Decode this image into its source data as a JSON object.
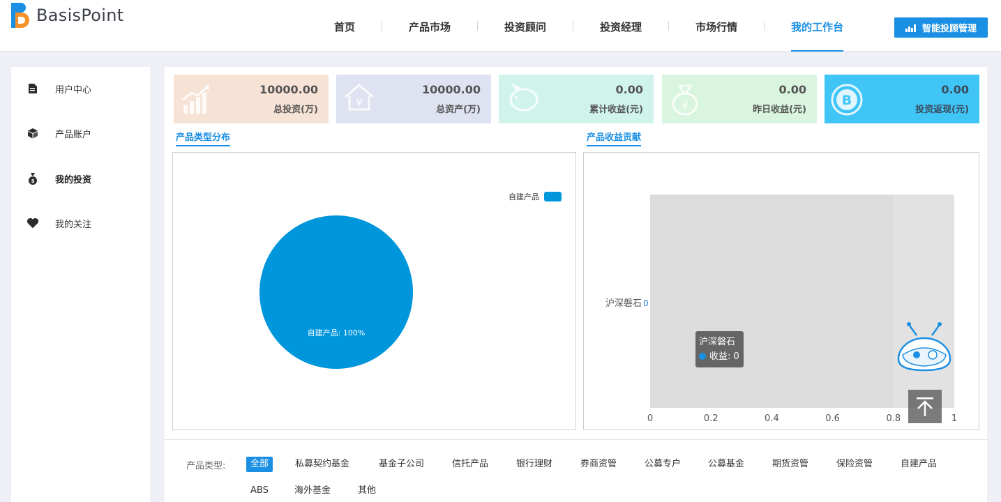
{
  "header": {
    "brand": "BasisPoint",
    "nav": [
      {
        "label": "首页",
        "active": false
      },
      {
        "label": "产品市场",
        "active": false
      },
      {
        "label": "投资顾问",
        "active": false
      },
      {
        "label": "投资经理",
        "active": false
      },
      {
        "label": "市场行情",
        "active": false
      },
      {
        "label": "我的工作台",
        "active": true
      }
    ],
    "smart_button": "智能投顾管理"
  },
  "sidebar": {
    "items": [
      {
        "label": "用户中心",
        "icon": "document-icon",
        "active": false
      },
      {
        "label": "产品账户",
        "icon": "box-icon",
        "active": false
      },
      {
        "label": "我的投资",
        "icon": "money-bag-icon",
        "active": true
      },
      {
        "label": "我的关注",
        "icon": "heart-icon",
        "active": false
      }
    ]
  },
  "cards": [
    {
      "value": "10000.00",
      "label": "总投资(万)",
      "color": "#f7e2d6",
      "icon": "growth-chart-icon"
    },
    {
      "value": "10000.00",
      "label": "总资产(万)",
      "color": "#dfe3f1",
      "icon": "house-yen-icon"
    },
    {
      "value": "0.00",
      "label": "累计收益(元)",
      "color": "#d0f4ec",
      "icon": "piggy-bank-icon"
    },
    {
      "value": "0.00",
      "label": "昨日收益(元)",
      "color": "#d9f5df",
      "icon": "money-bag-yen-icon"
    },
    {
      "value": "0.00",
      "label": "投资返现(元)",
      "color": "#3fc6f7",
      "icon": "bitcoin-icon"
    }
  ],
  "sections": {
    "distribution_title": "产品类型分布",
    "contribution_title": "产品收益贡献"
  },
  "chart_data": [
    {
      "type": "pie",
      "title": "",
      "legend": [
        "自建产品"
      ],
      "legend_position": "top-right",
      "slices": [
        {
          "name": "自建产品",
          "value": 100,
          "label": "自建产品: 100%",
          "color": "#0096dc"
        }
      ]
    },
    {
      "type": "bar",
      "orientation": "horizontal",
      "categories": [
        "沪深磐石"
      ],
      "series": [
        {
          "name": "收益",
          "values": [
            0
          ]
        }
      ],
      "data_label": "0",
      "xlim": [
        0,
        1
      ],
      "xticks": [
        "0",
        "0.2",
        "0.4",
        "0.6",
        "0.8",
        "1"
      ],
      "grid": false,
      "tooltip": {
        "title": "沪深磐石",
        "text": "收益: 0"
      }
    }
  ],
  "filter": {
    "label": "产品类型:",
    "options": [
      {
        "label": "全部",
        "active": true
      },
      {
        "label": "私募契约基金",
        "active": false
      },
      {
        "label": "基金子公司",
        "active": false
      },
      {
        "label": "信托产品",
        "active": false
      },
      {
        "label": "银行理财",
        "active": false
      },
      {
        "label": "券商资管",
        "active": false
      },
      {
        "label": "公募专户",
        "active": false
      },
      {
        "label": "公募基金",
        "active": false
      },
      {
        "label": "期货资管",
        "active": false
      },
      {
        "label": "保险资管",
        "active": false
      },
      {
        "label": "自建产品",
        "active": false
      },
      {
        "label": "ABS",
        "active": false
      },
      {
        "label": "海外基金",
        "active": false
      },
      {
        "label": "其他",
        "active": false
      }
    ]
  }
}
